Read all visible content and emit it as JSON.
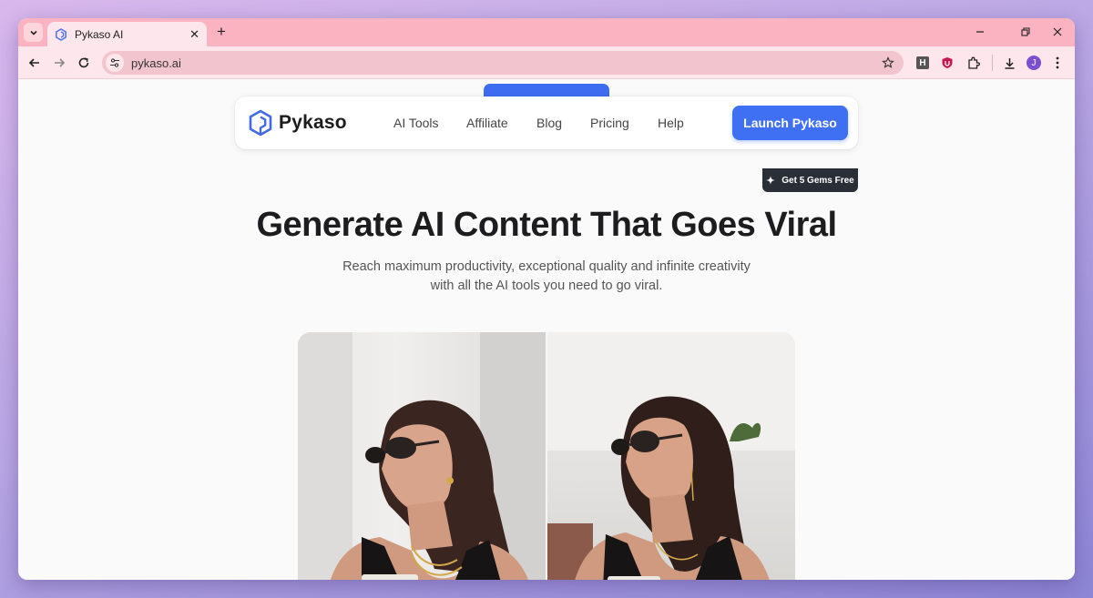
{
  "browser": {
    "tab_title": "Pykaso AI",
    "url": "pykaso.ai",
    "profile_initial": "J",
    "extension_h": "H"
  },
  "nav": {
    "brand": "Pykaso",
    "items": [
      "AI Tools",
      "Affiliate",
      "Blog",
      "Pricing",
      "Help"
    ],
    "cta": "Launch Pykaso",
    "badge": "Get 5 Gems Free"
  },
  "hero": {
    "title": "Generate AI Content That Goes Viral",
    "subtitle_line1": "Reach maximum productivity, exceptional quality and infinite creativity",
    "subtitle_line2": "with all the AI tools you need to go viral."
  },
  "icons": {
    "tab_list": "chevron-down-icon",
    "back": "arrow-left-icon",
    "forward": "arrow-right-icon",
    "reload": "reload-icon",
    "site_info": "tune-icon",
    "bookmark": "star-icon",
    "extensions": "puzzle-icon",
    "downloads": "download-icon",
    "menu": "kebab-menu-icon"
  },
  "colors": {
    "tab_strip": "#fbb3c1",
    "toolbar": "#fde7ec",
    "brand_blue": "#3f6ff2",
    "badge_dark": "#2a2e37"
  }
}
